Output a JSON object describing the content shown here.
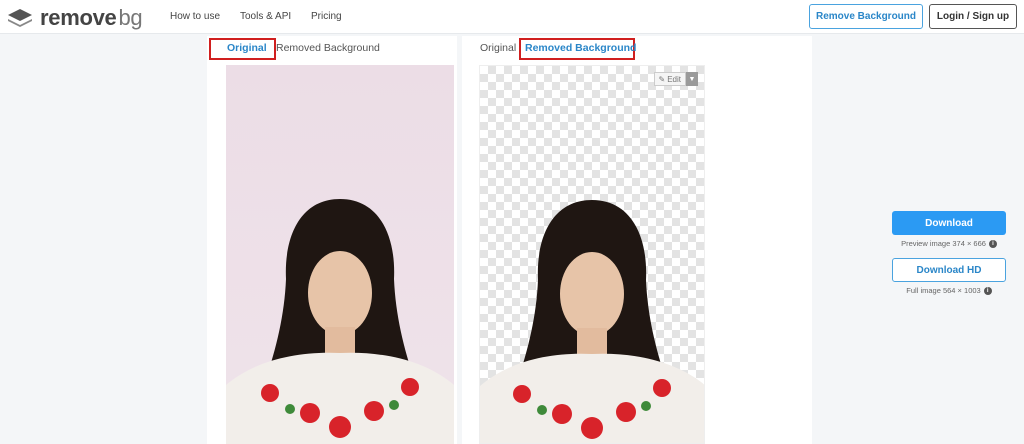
{
  "header": {
    "logo_text": "remove",
    "logo_text_suffix": "bg",
    "nav": [
      "How to use",
      "Tools & API",
      "Pricing"
    ],
    "remove_background_button": "Remove Background",
    "login_button": "Login / Sign up"
  },
  "left_panel": {
    "tab_original": "Original",
    "tab_removed": "Removed Background"
  },
  "right_panel": {
    "tab_original": "Original",
    "tab_removed": "Removed Background",
    "edit_label": "Edit"
  },
  "download": {
    "primary_label": "Download",
    "preview_caption": "Preview image 374 × 666",
    "hd_label": "Download HD",
    "full_caption": "Full image 564 × 1003"
  },
  "colors": {
    "accent": "#2b9af3",
    "highlight": "#d01f1f"
  }
}
